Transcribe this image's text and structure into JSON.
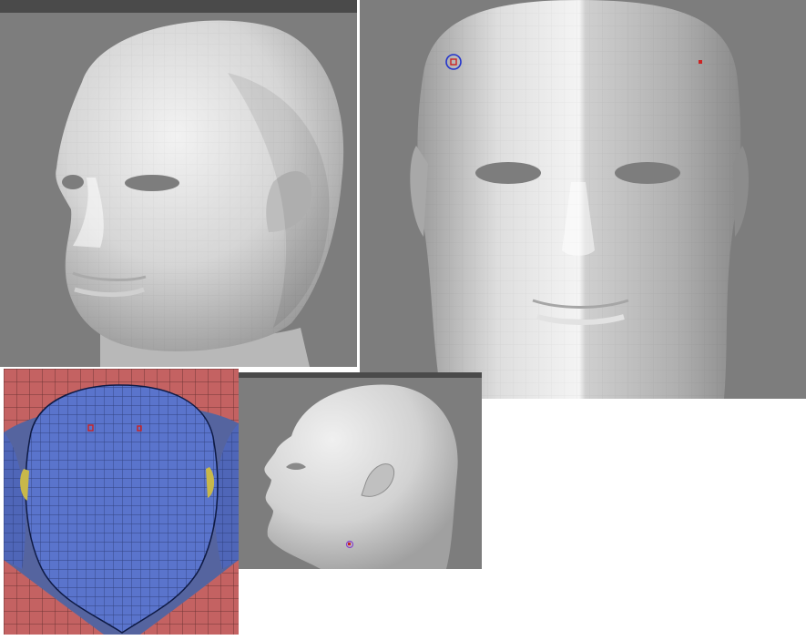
{
  "colors": {
    "viewport_bg": "#7d7d7d",
    "viewport_bar": "#4a4a4a",
    "skin_light": "#efefef",
    "skin_mid": "#c9c9c9",
    "skin_dark": "#8e8e8e",
    "uv_blue": "#5870c8",
    "uv_red": "#c46060",
    "uv_bg": "#55649f",
    "marker_red": "#cc2222",
    "marker_blue": "#2233cc",
    "marker_purple": "#8844cc"
  },
  "viewports": [
    {
      "name": "three-quarter-view",
      "content": "head-mesh-three-quarter"
    },
    {
      "name": "front-view",
      "content": "head-mesh-front",
      "markers": [
        "selected-vertex",
        "vertex-point"
      ]
    },
    {
      "name": "uv-layout-view",
      "content": "uv-map-head",
      "markers": [
        "uv-point-left",
        "uv-point-right"
      ]
    },
    {
      "name": "side-view",
      "content": "head-mesh-profile",
      "markers": [
        "pivot-marker"
      ]
    }
  ]
}
